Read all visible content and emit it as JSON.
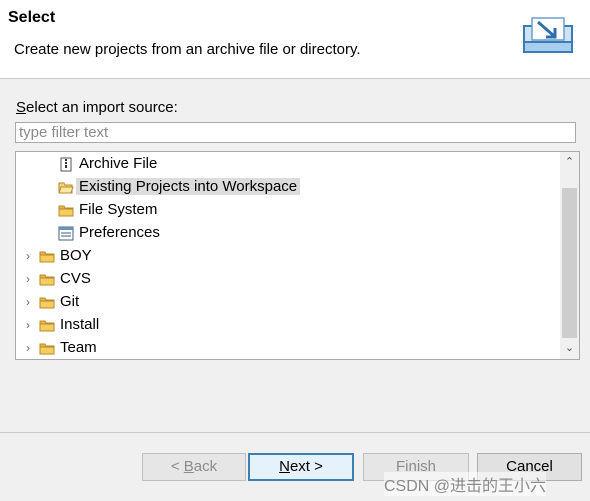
{
  "header": {
    "title": "Select",
    "description": "Create new projects from an archive file or directory."
  },
  "source": {
    "label_mnemonic": "S",
    "label_rest": "elect an import source:",
    "filter_placeholder": "type filter text"
  },
  "tree": {
    "items": [
      {
        "label": "Archive File",
        "icon": "archive-file-icon",
        "level": 1,
        "expandable": false
      },
      {
        "label": "Existing Projects into Workspace",
        "icon": "open-folder-icon",
        "level": 1,
        "expandable": false,
        "selected": true
      },
      {
        "label": "File System",
        "icon": "folder-icon",
        "level": 1,
        "expandable": false
      },
      {
        "label": "Preferences",
        "icon": "preferences-icon",
        "level": 1,
        "expandable": false
      },
      {
        "label": "BOY",
        "icon": "folder-icon",
        "level": 0,
        "expandable": true
      },
      {
        "label": "CVS",
        "icon": "folder-icon",
        "level": 0,
        "expandable": true
      },
      {
        "label": "Git",
        "icon": "folder-icon",
        "level": 0,
        "expandable": true
      },
      {
        "label": "Install",
        "icon": "folder-icon",
        "level": 0,
        "expandable": true
      },
      {
        "label": "Team",
        "icon": "folder-icon",
        "level": 0,
        "expandable": true
      }
    ]
  },
  "buttons": {
    "back_prefix": "< ",
    "back_mnemonic": "B",
    "back_rest": "ack",
    "next_mnemonic": "N",
    "next_rest": "ext >",
    "finish": "Finish",
    "cancel": "Cancel"
  },
  "watermark": "CSDN @进击的王小六",
  "colors": {
    "selection": "#dcdcdc",
    "folder": "#e8b840",
    "accent_border": "#3c7fb1"
  }
}
